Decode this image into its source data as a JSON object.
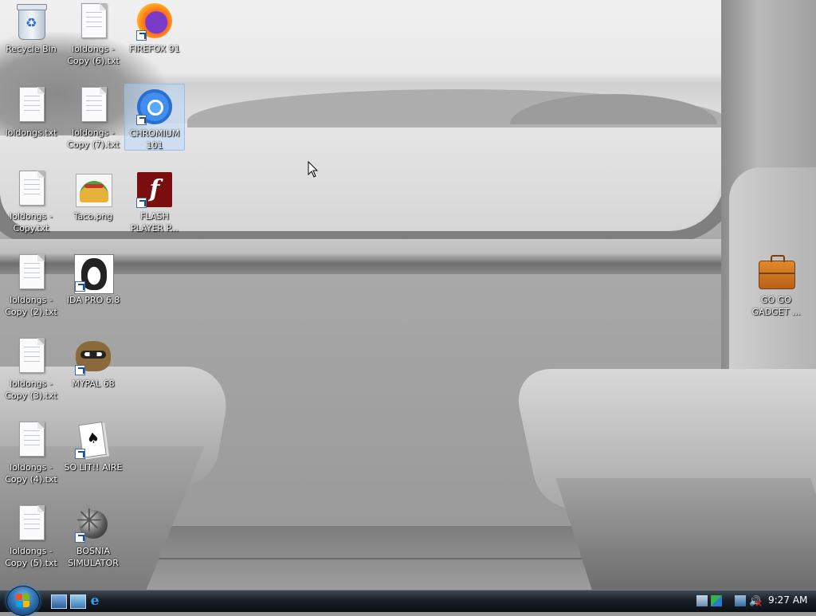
{
  "desktop": {
    "icons": [
      {
        "id": "recycle-bin",
        "label": "Recycle Bin",
        "icon": "recycle-bin-icon"
      },
      {
        "id": "loldongs-copy-6",
        "label": "loldongs - Copy (6).txt",
        "icon": "text-file-icon"
      },
      {
        "id": "firefox-91",
        "label": "FIREFOX 91",
        "icon": "firefox-icon"
      },
      {
        "id": "loldongs",
        "label": "loldongs.txt",
        "icon": "text-file-icon"
      },
      {
        "id": "loldongs-copy-7",
        "label": "loldongs - Copy (7).txt",
        "icon": "text-file-icon"
      },
      {
        "id": "chromium-101",
        "label": "CHROMIUM 101",
        "icon": "chromium-icon"
      },
      {
        "id": "loldongs-copy",
        "label": "loldongs - Copy.txt",
        "icon": "text-file-icon"
      },
      {
        "id": "taco-png",
        "label": "Taco.png",
        "icon": "taco-image-icon"
      },
      {
        "id": "flash-player",
        "label": "FLASH PLAYER P...",
        "icon": "flash-player-icon"
      },
      {
        "id": "loldongs-copy-2",
        "label": "loldongs - Copy (2).txt",
        "icon": "text-file-icon"
      },
      {
        "id": "ida-pro",
        "label": "IDA PRO 6.8",
        "icon": "ida-pro-icon"
      },
      {
        "id": "loldongs-copy-3",
        "label": "loldongs - Copy (3).txt",
        "icon": "text-file-icon"
      },
      {
        "id": "mypal-68",
        "label": "MYPAL 68",
        "icon": "raccoon-icon"
      },
      {
        "id": "loldongs-copy-4",
        "label": "loldongs - Copy (4).txt",
        "icon": "text-file-icon"
      },
      {
        "id": "solitaire",
        "label": "SO LIT!! AIRE",
        "icon": "playing-cards-icon"
      },
      {
        "id": "loldongs-copy-5",
        "label": "loldongs - Copy (5).txt",
        "icon": "text-file-icon"
      },
      {
        "id": "bosnia-simulator",
        "label": "BOSNIA SIMULATOR",
        "icon": "mine-icon"
      },
      {
        "id": "go-go-gadget",
        "label": "GO GO GADGET ...",
        "icon": "briefcase-icon"
      }
    ],
    "selected_icon": "CHROMIUM 101"
  },
  "taskbar": {
    "start_button": "start-orb-icon",
    "quick_launch": [
      "show-desktop-icon",
      "switch-windows-icon",
      "internet-explorer-icon"
    ],
    "tray_icons": [
      "tray-app-icon",
      "tray-security-icon",
      "network-icon",
      "volume-muted-icon"
    ],
    "clock": "9:27 AM"
  },
  "colors": {
    "taskbar": "#1a2028",
    "selection": "#b4d7ff",
    "label_text": "#ffffff"
  }
}
